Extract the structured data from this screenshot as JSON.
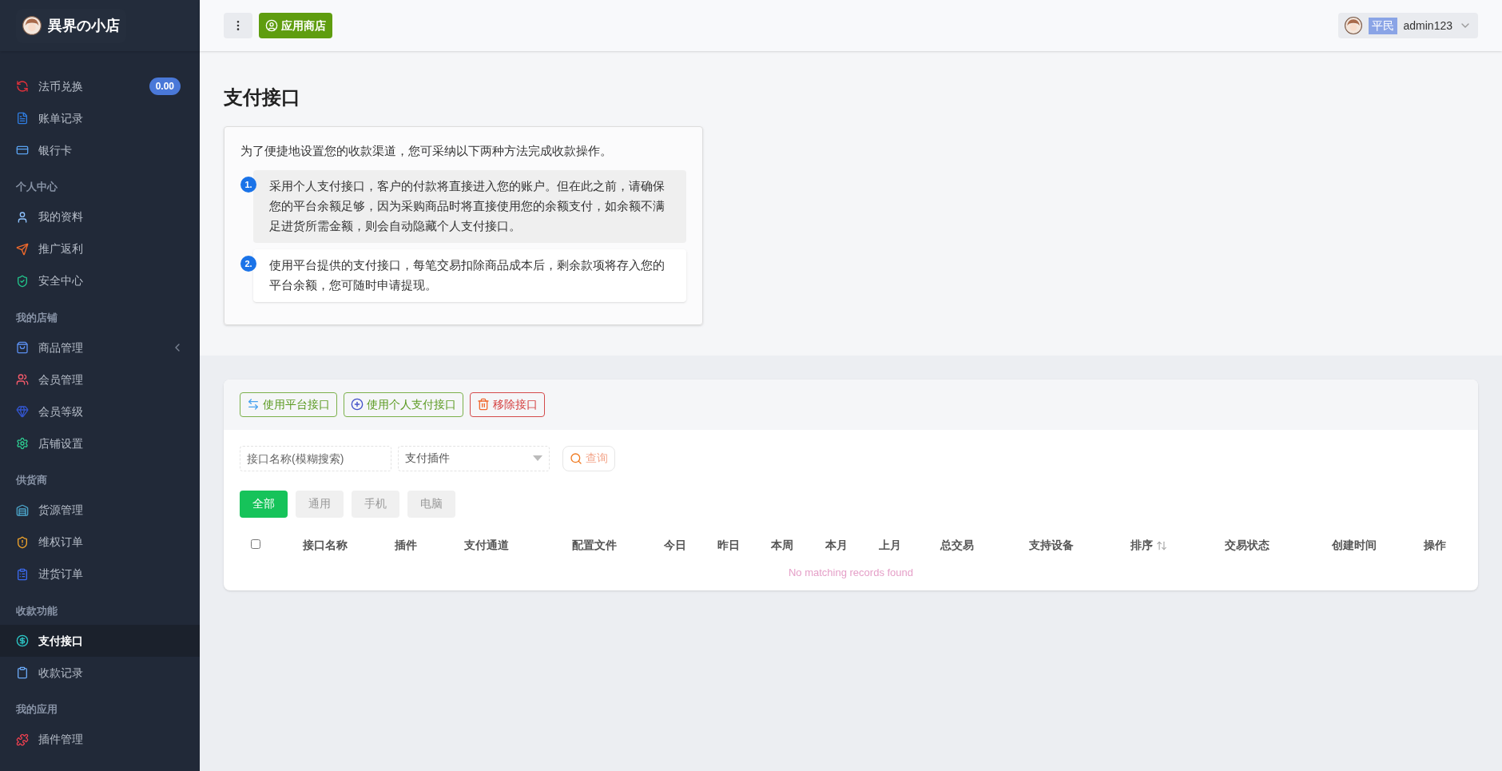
{
  "sidebar": {
    "brand": "異界の小店",
    "sections": [
      {
        "items": [
          {
            "label": "法币兑换",
            "badge": "0.00",
            "kind": "link",
            "selected": false
          },
          {
            "label": "账单记录",
            "kind": "link",
            "selected": false
          },
          {
            "label": "银行卡",
            "kind": "link",
            "selected": false
          }
        ]
      },
      {
        "title": "个人中心",
        "items": [
          {
            "label": "我的资料",
            "kind": "link",
            "selected": false
          },
          {
            "label": "推广返利",
            "kind": "link",
            "selected": false
          },
          {
            "label": "安全中心",
            "kind": "link",
            "selected": false
          }
        ]
      },
      {
        "title": "我的店铺",
        "items": [
          {
            "label": "商品管理",
            "kind": "group",
            "selected": false
          },
          {
            "label": "会员管理",
            "kind": "link",
            "selected": false
          },
          {
            "label": "会员等级",
            "kind": "link",
            "selected": false
          },
          {
            "label": "店铺设置",
            "kind": "link",
            "selected": false
          }
        ]
      },
      {
        "title": "供货商",
        "items": [
          {
            "label": "货源管理",
            "kind": "link",
            "selected": false
          },
          {
            "label": "维权订单",
            "kind": "link",
            "selected": false
          },
          {
            "label": "进货订单",
            "kind": "link",
            "selected": false
          }
        ]
      },
      {
        "title": "收款功能",
        "items": [
          {
            "label": "支付接口",
            "kind": "link",
            "selected": true
          },
          {
            "label": "收款记录",
            "kind": "link",
            "selected": false
          }
        ]
      },
      {
        "title": "我的应用",
        "items": [
          {
            "label": "插件管理",
            "kind": "link",
            "selected": false
          }
        ]
      }
    ]
  },
  "header": {
    "app_store": "应用商店",
    "user": {
      "role": "平民",
      "name": "admin123"
    }
  },
  "page_title": "支付接口",
  "intro": {
    "text": "为了便捷地设置您的收款渠道，您可采纳以下两种方法完成收款操作。",
    "steps": [
      {
        "number": "1.",
        "text": "采用个人支付接口，客户的付款将直接进入您的账户。但在此之前，请确保您的平台余额足够，因为采购商品时将直接使用您的余额支付，如余额不满足进货所需金额，则会自动隐藏个人支付接口。",
        "highlighted": true
      },
      {
        "number": "2.",
        "text": "使用平台提供的支付接口，每笔交易扣除商品成本后，剩余款项将存入您的平台余额，您可随时申请提现。",
        "highlighted": false
      }
    ]
  },
  "toolbar": [
    {
      "label": "使用平台接口",
      "kind": "success"
    },
    {
      "label": "使用个人支付接口",
      "kind": "success"
    },
    {
      "label": "移除接口",
      "kind": "danger"
    }
  ],
  "filters": {
    "search_placeholder": "接口名称(模糊搜索)",
    "plugin_placeholder": "支付插件",
    "query": "查询"
  },
  "device_tabs": [
    {
      "label": "全部",
      "selected": true
    },
    {
      "label": "通用",
      "selected": false
    },
    {
      "label": "手机",
      "selected": false
    },
    {
      "label": "电脑",
      "selected": false
    }
  ],
  "table": {
    "select_all_checked": false,
    "columns": [
      {
        "label": "接口名称",
        "sortable": false
      },
      {
        "label": "插件",
        "sortable": false
      },
      {
        "label": "支付通道",
        "sortable": false
      },
      {
        "label": "配置文件",
        "sortable": false
      },
      {
        "label": "今日",
        "sortable": false
      },
      {
        "label": "昨日",
        "sortable": false
      },
      {
        "label": "本周",
        "sortable": false
      },
      {
        "label": "本月",
        "sortable": false
      },
      {
        "label": "上月",
        "sortable": false
      },
      {
        "label": "总交易",
        "sortable": false
      },
      {
        "label": "支持设备",
        "sortable": false
      },
      {
        "label": "排序",
        "sortable": true
      },
      {
        "label": "交易状态",
        "sortable": false
      },
      {
        "label": "创建时间",
        "sortable": false
      },
      {
        "label": "操作",
        "sortable": false
      }
    ],
    "empty_message": "No matching records found"
  }
}
